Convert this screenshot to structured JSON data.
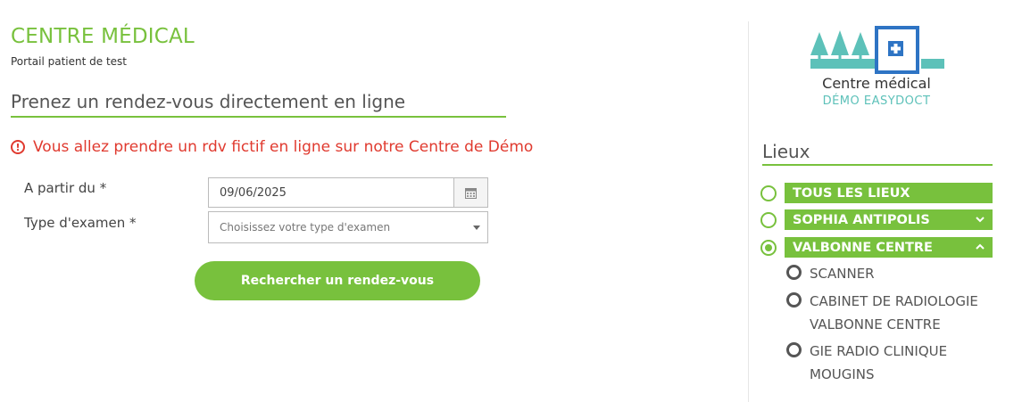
{
  "header": {
    "title": "CENTRE MÉDICAL",
    "subtitle": "Portail patient de test"
  },
  "main": {
    "heading": "Prenez un rendez-vous directement en ligne",
    "alert": "Vous allez prendre un rdv fictif en ligne sur notre Centre de Démo",
    "date_label": "A partir du *",
    "date_value": "09/06/2025",
    "exam_label": "Type d'examen *",
    "exam_placeholder": "Choisissez votre type d'examen",
    "search_button": "Rechercher un rendez-vous"
  },
  "logo": {
    "line1": "Centre médical",
    "line2": "DÉMO EASYDOCT"
  },
  "sidebar": {
    "title": "Lieux",
    "locations": [
      {
        "label": "TOUS LES LIEUX",
        "selected": false,
        "chevron": "none"
      },
      {
        "label": "SOPHIA ANTIPOLIS",
        "selected": false,
        "chevron": "down"
      },
      {
        "label": "VALBONNE CENTRE",
        "selected": true,
        "chevron": "up"
      }
    ],
    "sublocations": [
      {
        "label": "SCANNER"
      },
      {
        "label": "CABINET DE RADIOLOGIE VALBONNE CENTRE"
      },
      {
        "label": "GIE RADIO CLINIQUE MOUGINS"
      }
    ]
  },
  "colors": {
    "brand_green": "#78c13d",
    "alert_red": "#e03a2f",
    "logo_teal": "#5dc1b9",
    "logo_blue": "#2e74c4"
  }
}
